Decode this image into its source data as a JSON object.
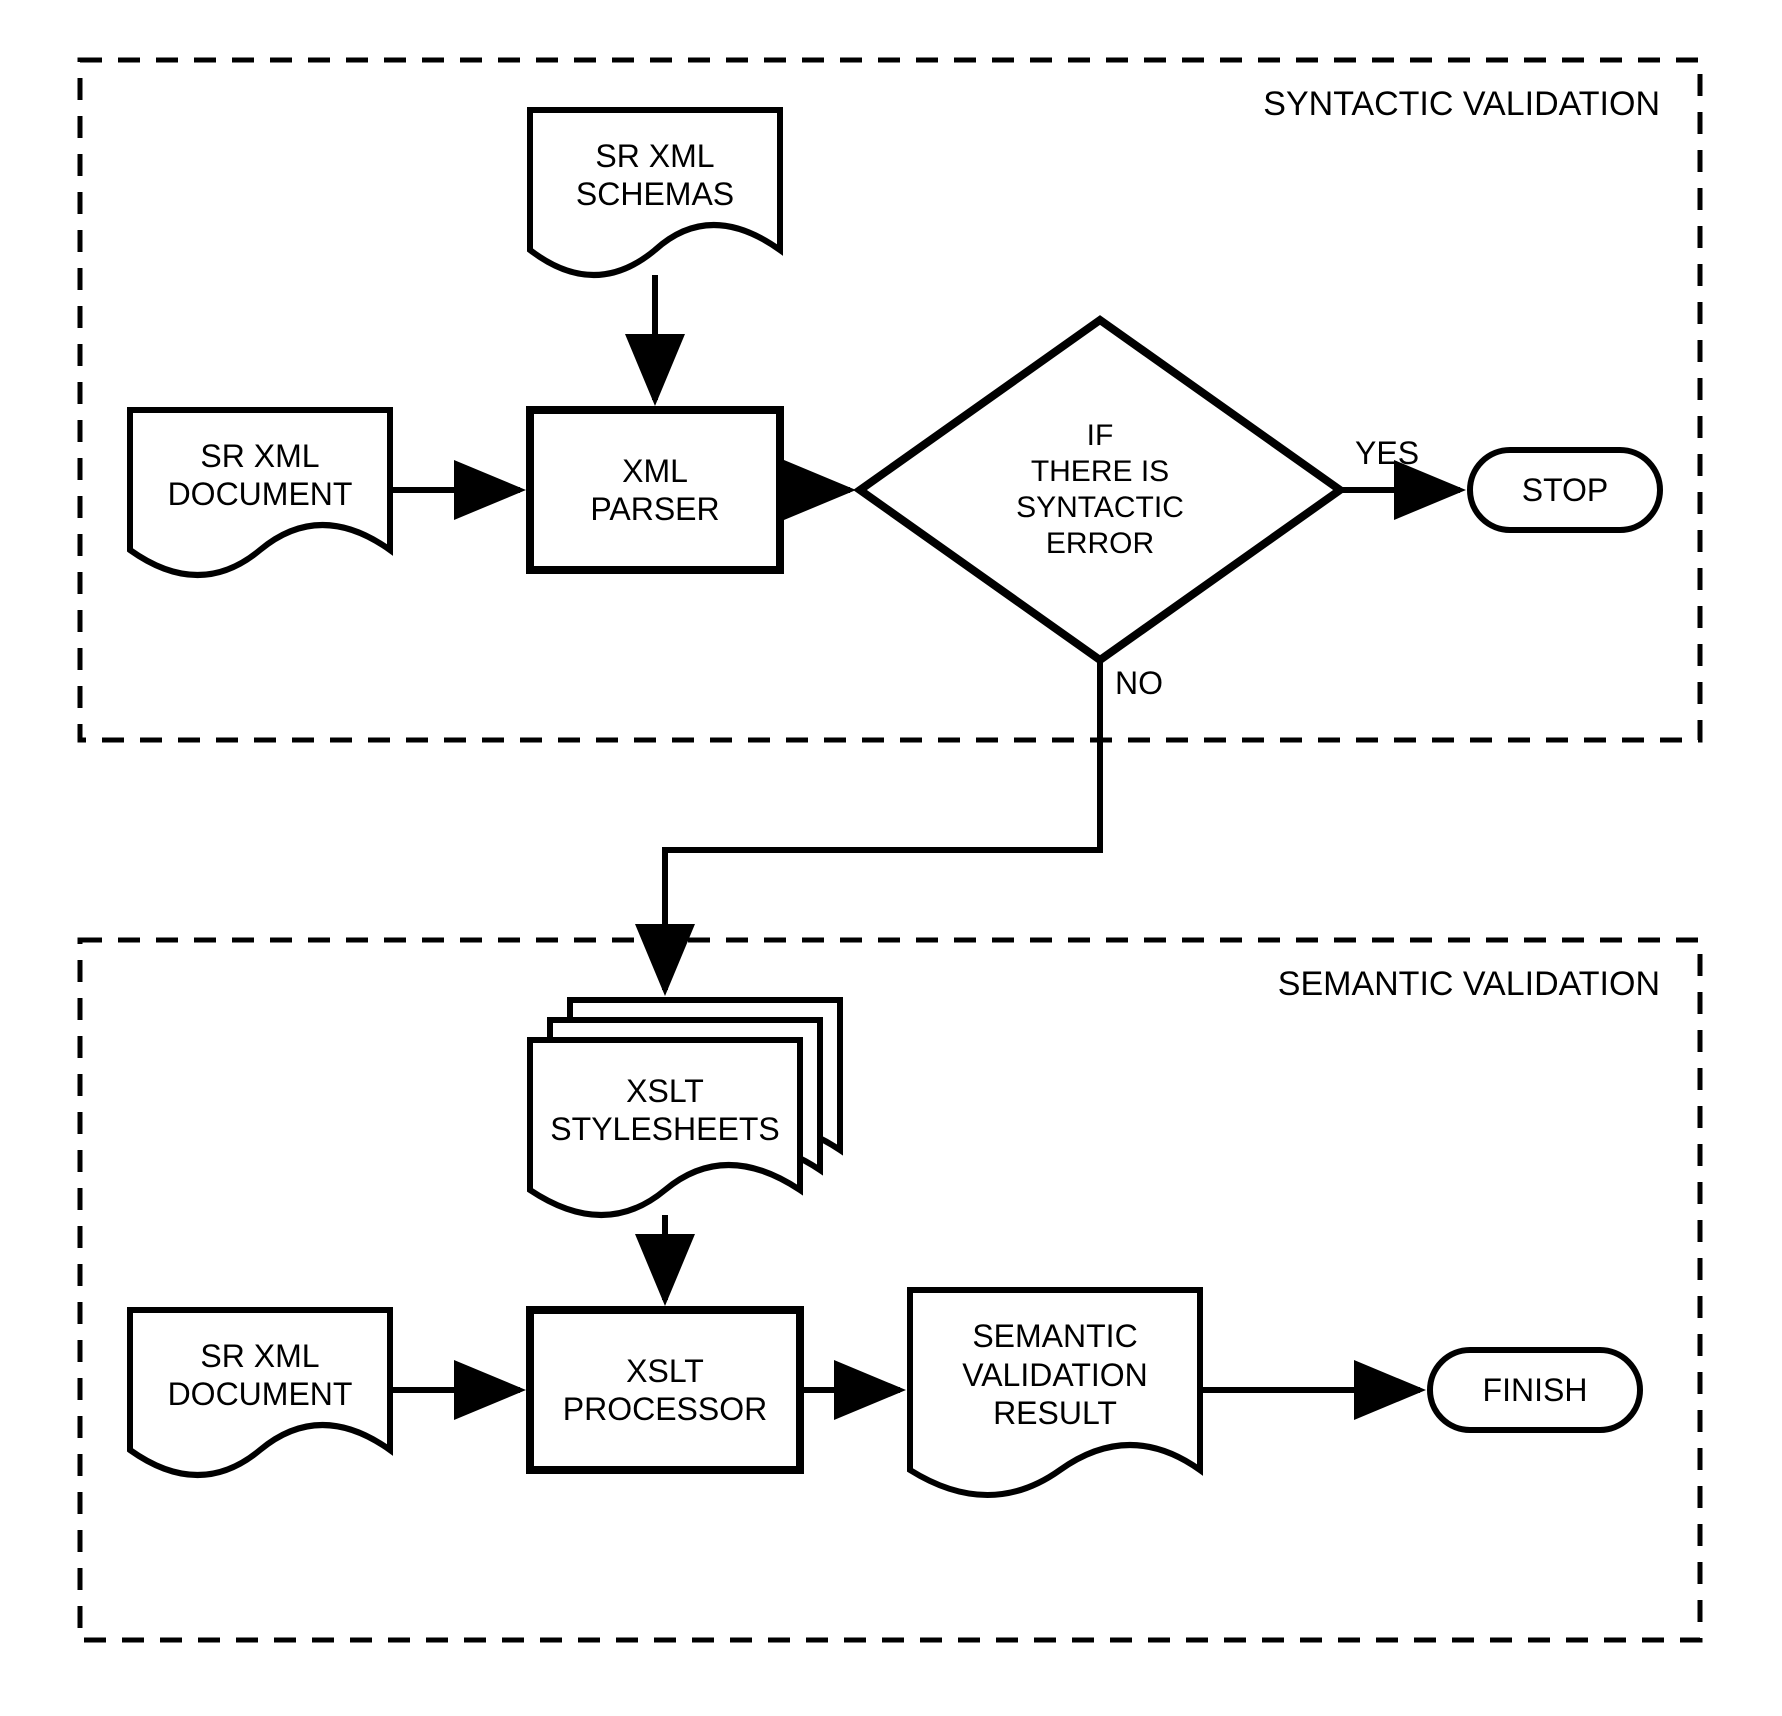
{
  "sections": {
    "top": "SYNTACTIC VALIDATION",
    "bottom": "SEMANTIC VALIDATION"
  },
  "nodes": {
    "doc1": "SR XML\nDOCUMENT",
    "schemas": "SR XML\nSCHEMAS",
    "parser": "XML\nPARSER",
    "decision": "IF\nTHERE IS\nSYNTACTIC\nERROR",
    "stop": "STOP",
    "doc2": "SR XML\nDOCUMENT",
    "stylesheets": "XSLT\nSTYLESHEETS",
    "processor": "XSLT\nPROCESSOR",
    "result": "SEMANTIC\nVALIDATION\nRESULT",
    "finish": "FINISH"
  },
  "edges": {
    "yes": "YES",
    "no": "NO"
  }
}
